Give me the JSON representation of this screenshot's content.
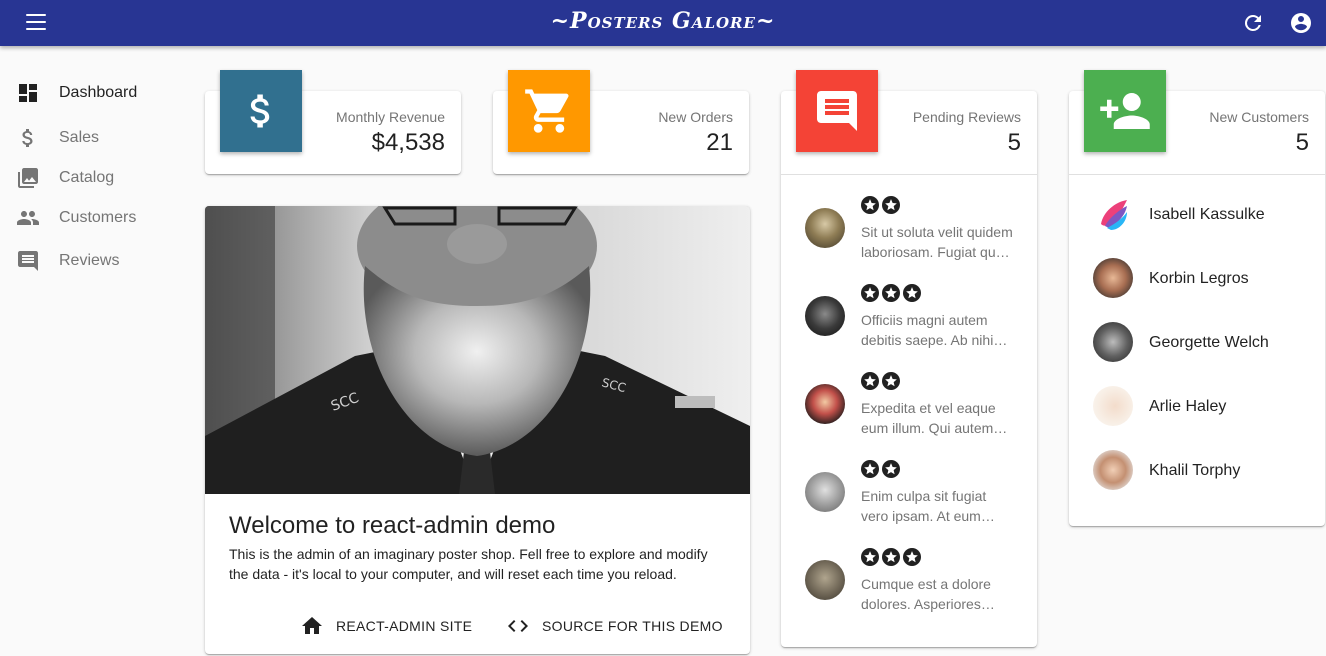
{
  "appbar": {
    "title": "~Posters Galore~"
  },
  "sidebar": {
    "items": [
      {
        "label": "Dashboard",
        "icon": "dashboard-icon"
      },
      {
        "label": "Sales",
        "icon": "dollar-icon"
      },
      {
        "label": "Catalog",
        "icon": "collections-icon"
      },
      {
        "label": "Customers",
        "icon": "people-icon"
      },
      {
        "label": "Reviews",
        "icon": "comment-icon"
      }
    ]
  },
  "stats": {
    "revenue": {
      "label": "Monthly Revenue",
      "value": "$4,538",
      "color": "#31708f"
    },
    "orders": {
      "label": "New Orders",
      "value": "21",
      "color": "#ff9800"
    },
    "reviews": {
      "label": "Pending Reviews",
      "value": "5",
      "color": "#f44336"
    },
    "customers": {
      "label": "New Customers",
      "value": "5",
      "color": "#4caf50"
    }
  },
  "welcome": {
    "title": "Welcome to react-admin demo",
    "text": "This is the admin of an imaginary poster shop. Fell free to explore and modify the data - it's local to your computer, and will reset each time you reload.",
    "actions": [
      {
        "label": "REACT-ADMIN SITE",
        "icon": "home-icon"
      },
      {
        "label": "SOURCE FOR THIS DEMO",
        "icon": "code-icon"
      }
    ]
  },
  "reviews": [
    {
      "stars": 2,
      "line1": "Sit ut soluta velit quidem",
      "line2": "laboriosam. Fugiat qu…"
    },
    {
      "stars": 3,
      "line1": "Officiis magni autem",
      "line2": "debitis saepe. Ab nihi…"
    },
    {
      "stars": 2,
      "line1": "Expedita et vel eaque",
      "line2": "eum illum. Qui autem…"
    },
    {
      "stars": 2,
      "line1": "Enim culpa sit fugiat",
      "line2": "vero ipsam. At eum…"
    },
    {
      "stars": 3,
      "line1": "Cumque est a dolore",
      "line2": "dolores. Asperiores…"
    }
  ],
  "customers": [
    {
      "name": "Isabell Kassulke"
    },
    {
      "name": "Korbin Legros"
    },
    {
      "name": "Georgette Welch"
    },
    {
      "name": "Arlie Haley"
    },
    {
      "name": "Khalil Torphy"
    }
  ]
}
